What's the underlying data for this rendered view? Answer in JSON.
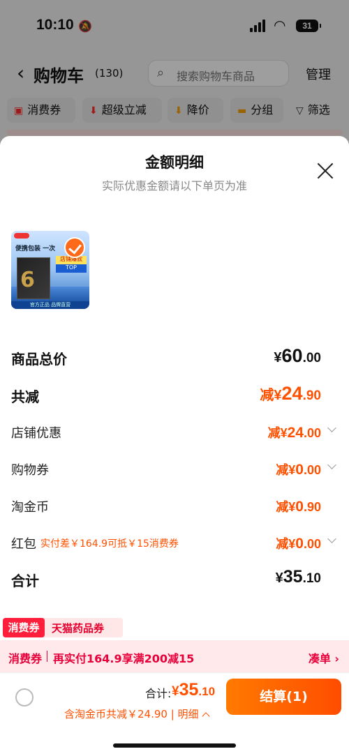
{
  "status": {
    "time": "10:10",
    "battery": "31"
  },
  "nav": {
    "title": "购物车",
    "count": "(130)",
    "search_placeholder": "搜索购物车商品",
    "manage": "管理"
  },
  "filters": [
    {
      "label": "消费券",
      "icon": "coupon-icon"
    },
    {
      "label": "超级立减",
      "icon": "arrow-down-icon"
    },
    {
      "label": "降价",
      "icon": "price-drop-icon"
    },
    {
      "label": "分组",
      "icon": "folder-icon"
    },
    {
      "label": "筛选",
      "icon": "filter-icon"
    }
  ],
  "sheet": {
    "title": "金额明细",
    "subtitle": "实际优惠金额请以下单页为准",
    "product_image_text": {
      "head": "便携包装 一次",
      "flag": "店铺爆款",
      "top": "TOP",
      "footer": "官方正品 品牌直营"
    },
    "rows": {
      "goods_total": {
        "label": "商品总价",
        "cur": "¥",
        "int": "60",
        "dec": ".00"
      },
      "total_discount": {
        "label": "共减",
        "prefix": "减",
        "cur": "¥",
        "int": "24",
        "dec": ".90"
      },
      "store_discount": {
        "label": "店铺优惠",
        "prefix": "减",
        "cur": "¥",
        "int": "24",
        "dec": ".00"
      },
      "shopping_coupon": {
        "label": "购物券",
        "prefix": "减",
        "cur": "¥",
        "int": "0",
        "dec": ".00"
      },
      "taojinbi": {
        "label": "淘金币",
        "prefix": "减",
        "cur": "¥",
        "int": "0",
        "dec": ".90"
      },
      "red_packet": {
        "label": "红包",
        "note": "实付差￥164.9可抵￥15消费券",
        "prefix": "减",
        "cur": "¥",
        "int": "0",
        "dec": ".00"
      },
      "sum": {
        "label": "合计",
        "cur": "¥",
        "int": "35",
        "dec": ".10"
      }
    }
  },
  "coupon_tag": {
    "badge": "消费券",
    "text": "天猫药品券"
  },
  "promo": {
    "lead": "消费券",
    "message": "再实付164.9享满200减15",
    "action": "凑单 ›"
  },
  "bottom": {
    "total_label": "合计:",
    "cur": "¥",
    "int": "35",
    "dec": ".10",
    "detail": "含淘金币共减￥24.90 | 明细",
    "settle": "结算(1)"
  },
  "colors": {
    "accent": "#ff5000",
    "promo": "#e8003b"
  }
}
